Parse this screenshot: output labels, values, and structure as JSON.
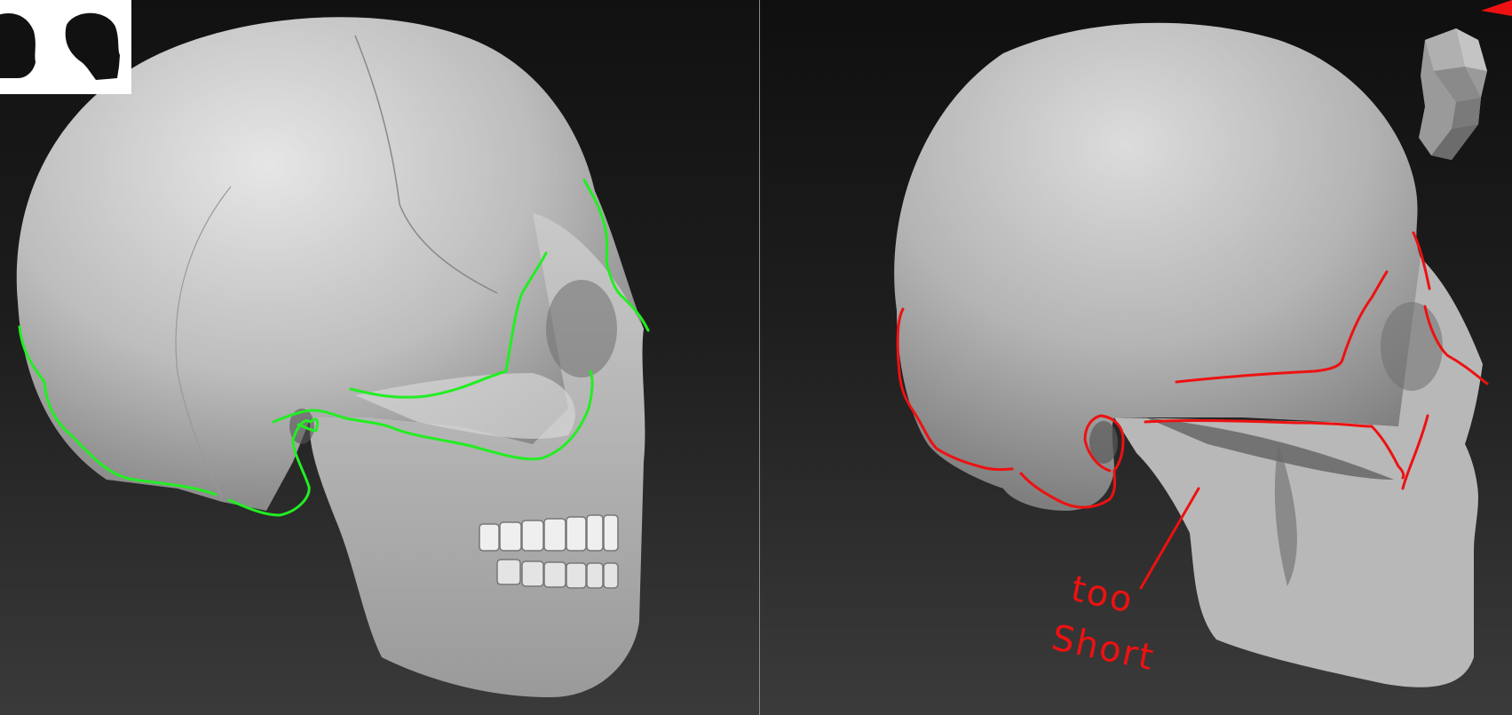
{
  "colors": {
    "background": "#1a1a1a",
    "divider": "#8a8a8a",
    "skull": "#c8c8c8",
    "reference_lines": "#22ee22",
    "critique_lines": "#ee1111"
  },
  "panels": {
    "left": {
      "content": "reference-skull-side-view",
      "overlay": "green-landmark-lines"
    },
    "right": {
      "content": "sculpted-skull-side-view",
      "overlay": "red-correction-lines"
    }
  },
  "icons": {
    "thumbnail_left": "skull-silhouette-icon",
    "thumbnail_right": "skull-silhouette-icon",
    "navigation": "head-navigation-cube-icon",
    "corner_marker": "red-corner-marker-icon"
  },
  "annotations": {
    "critique_line1": "too",
    "critique_line2": "Short"
  }
}
